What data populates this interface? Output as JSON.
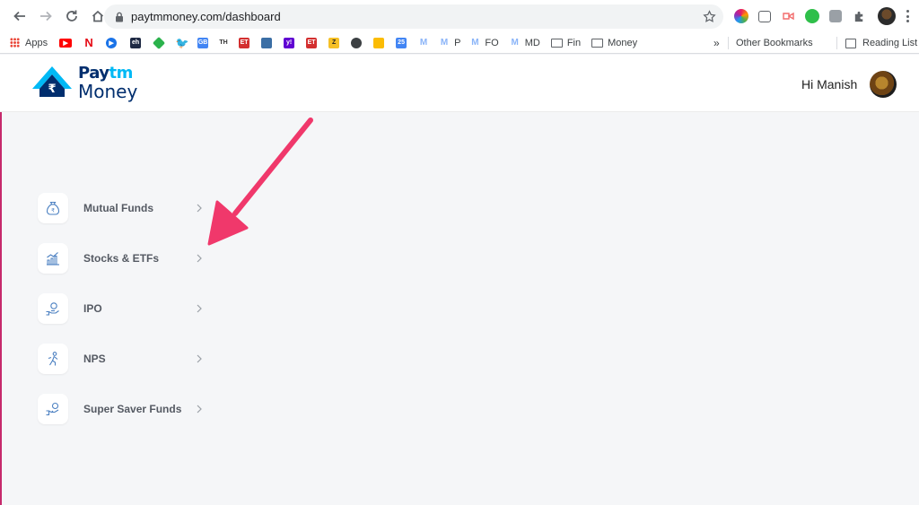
{
  "browser": {
    "url": "paytmmoney.com/dashboard",
    "bookmarks": {
      "apps": "Apps",
      "th": "TH",
      "et": "ET",
      "p": "P",
      "fo": "FO",
      "md": "MD",
      "fin": "Fin",
      "money": "Money",
      "overflow": "»",
      "other": "Other Bookmarks",
      "reading": "Reading List"
    }
  },
  "header": {
    "brand_top_left": "Pay",
    "brand_top_right": "tm",
    "brand_bottom": "Money",
    "greeting": "Hi Manish"
  },
  "menu": [
    {
      "label": "Mutual Funds",
      "icon": "money-bag-icon"
    },
    {
      "label": "Stocks & ETFs",
      "icon": "bar-chart-icon"
    },
    {
      "label": "IPO",
      "icon": "hand-coin-icon"
    },
    {
      "label": "NPS",
      "icon": "retirement-icon"
    },
    {
      "label": "Super Saver Funds",
      "icon": "savings-icon"
    }
  ],
  "colors": {
    "brand_blue": "#00b9f5",
    "brand_navy": "#002e6e",
    "annotation_arrow": "#f0386b",
    "page_background": "#f5f6f8"
  }
}
